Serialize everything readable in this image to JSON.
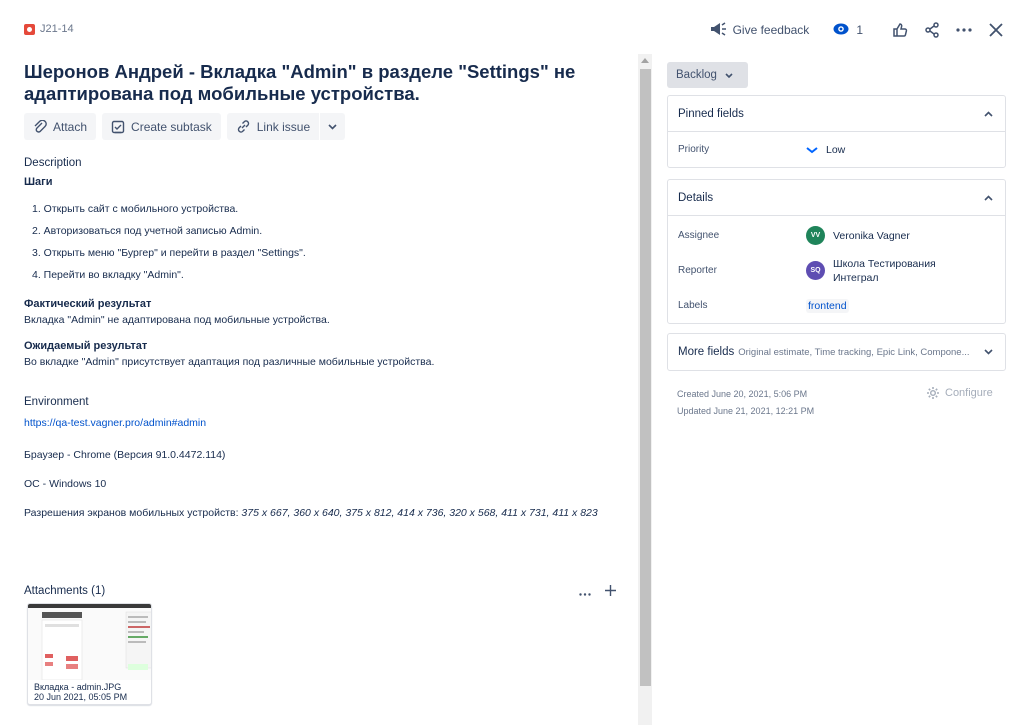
{
  "header": {
    "issue_key": "J21-14",
    "feedback_label": "Give feedback",
    "watchers_count": "1"
  },
  "issue": {
    "title": "Шеронов Андрей - Вкладка \"Admin\" в разделе \"Settings\" не адаптирована под мобильные устройства.",
    "buttons": {
      "attach": "Attach",
      "create_subtask": "Create subtask",
      "link_issue": "Link issue"
    },
    "description": {
      "label": "Description",
      "steps_heading": "Шаги",
      "steps": [
        "1. Открыть сайт с мобильного устройства.",
        "2. Авторизоваться под учетной записью Admin.",
        "3. Открыть меню \"Бургер\" и перейти в раздел \"Settings\".",
        "4. Перейти во вкладку \"Admin\"."
      ],
      "actual_heading": "Фактический результат",
      "actual_text": "Вкладка \"Admin\" не адаптирована под мобильные устройства.",
      "expected_heading": "Ожидаемый результат",
      "expected_text": "Во вкладке \"Admin\" присутствует адаптация под различные мобильные устройства."
    },
    "environment": {
      "label": "Environment",
      "link": "https://qa-test.vagner.pro/admin#admin",
      "browser": "Браузер - Chrome (Версия 91.0.4472.114)",
      "os": "ОС - Windows 10",
      "resolutions_prefix": "Разрешения экранов мобильных устройств: ",
      "resolutions_values": "375 x 667, 360 x 640, 375 x 812, 414 x 736,  320 x 568, 411 x 731, 411 x 823"
    },
    "attachments": {
      "heading": "Attachments (1)",
      "file_name": "Вкладка - admin.JPG",
      "file_date": "20 Jun 2021, 05:05 PM"
    }
  },
  "sidebar": {
    "status": "Backlog",
    "pinned": {
      "title": "Pinned fields",
      "priority_label": "Priority",
      "priority_value": "Low"
    },
    "details": {
      "title": "Details",
      "assignee_label": "Assignee",
      "assignee_initials": "VV",
      "assignee_name": "Veronika Vagner",
      "assignee_color": "#1f845a",
      "reporter_label": "Reporter",
      "reporter_initials": "SQ",
      "reporter_name": "Школа Тестирования Интеграл",
      "reporter_color": "#5e4db2",
      "labels_label": "Labels",
      "labels_value": "frontend"
    },
    "more_fields": {
      "title": "More fields",
      "subtitle": "Original estimate, Time tracking, Epic Link, Compone..."
    },
    "created": "Created June 20, 2021, 5:06 PM",
    "updated": "Updated June 21, 2021, 12:21 PM",
    "configure": "Configure"
  },
  "colors": {
    "link": "#0052cc",
    "priority_low": "#0065ff",
    "bug": "#e5493a"
  }
}
